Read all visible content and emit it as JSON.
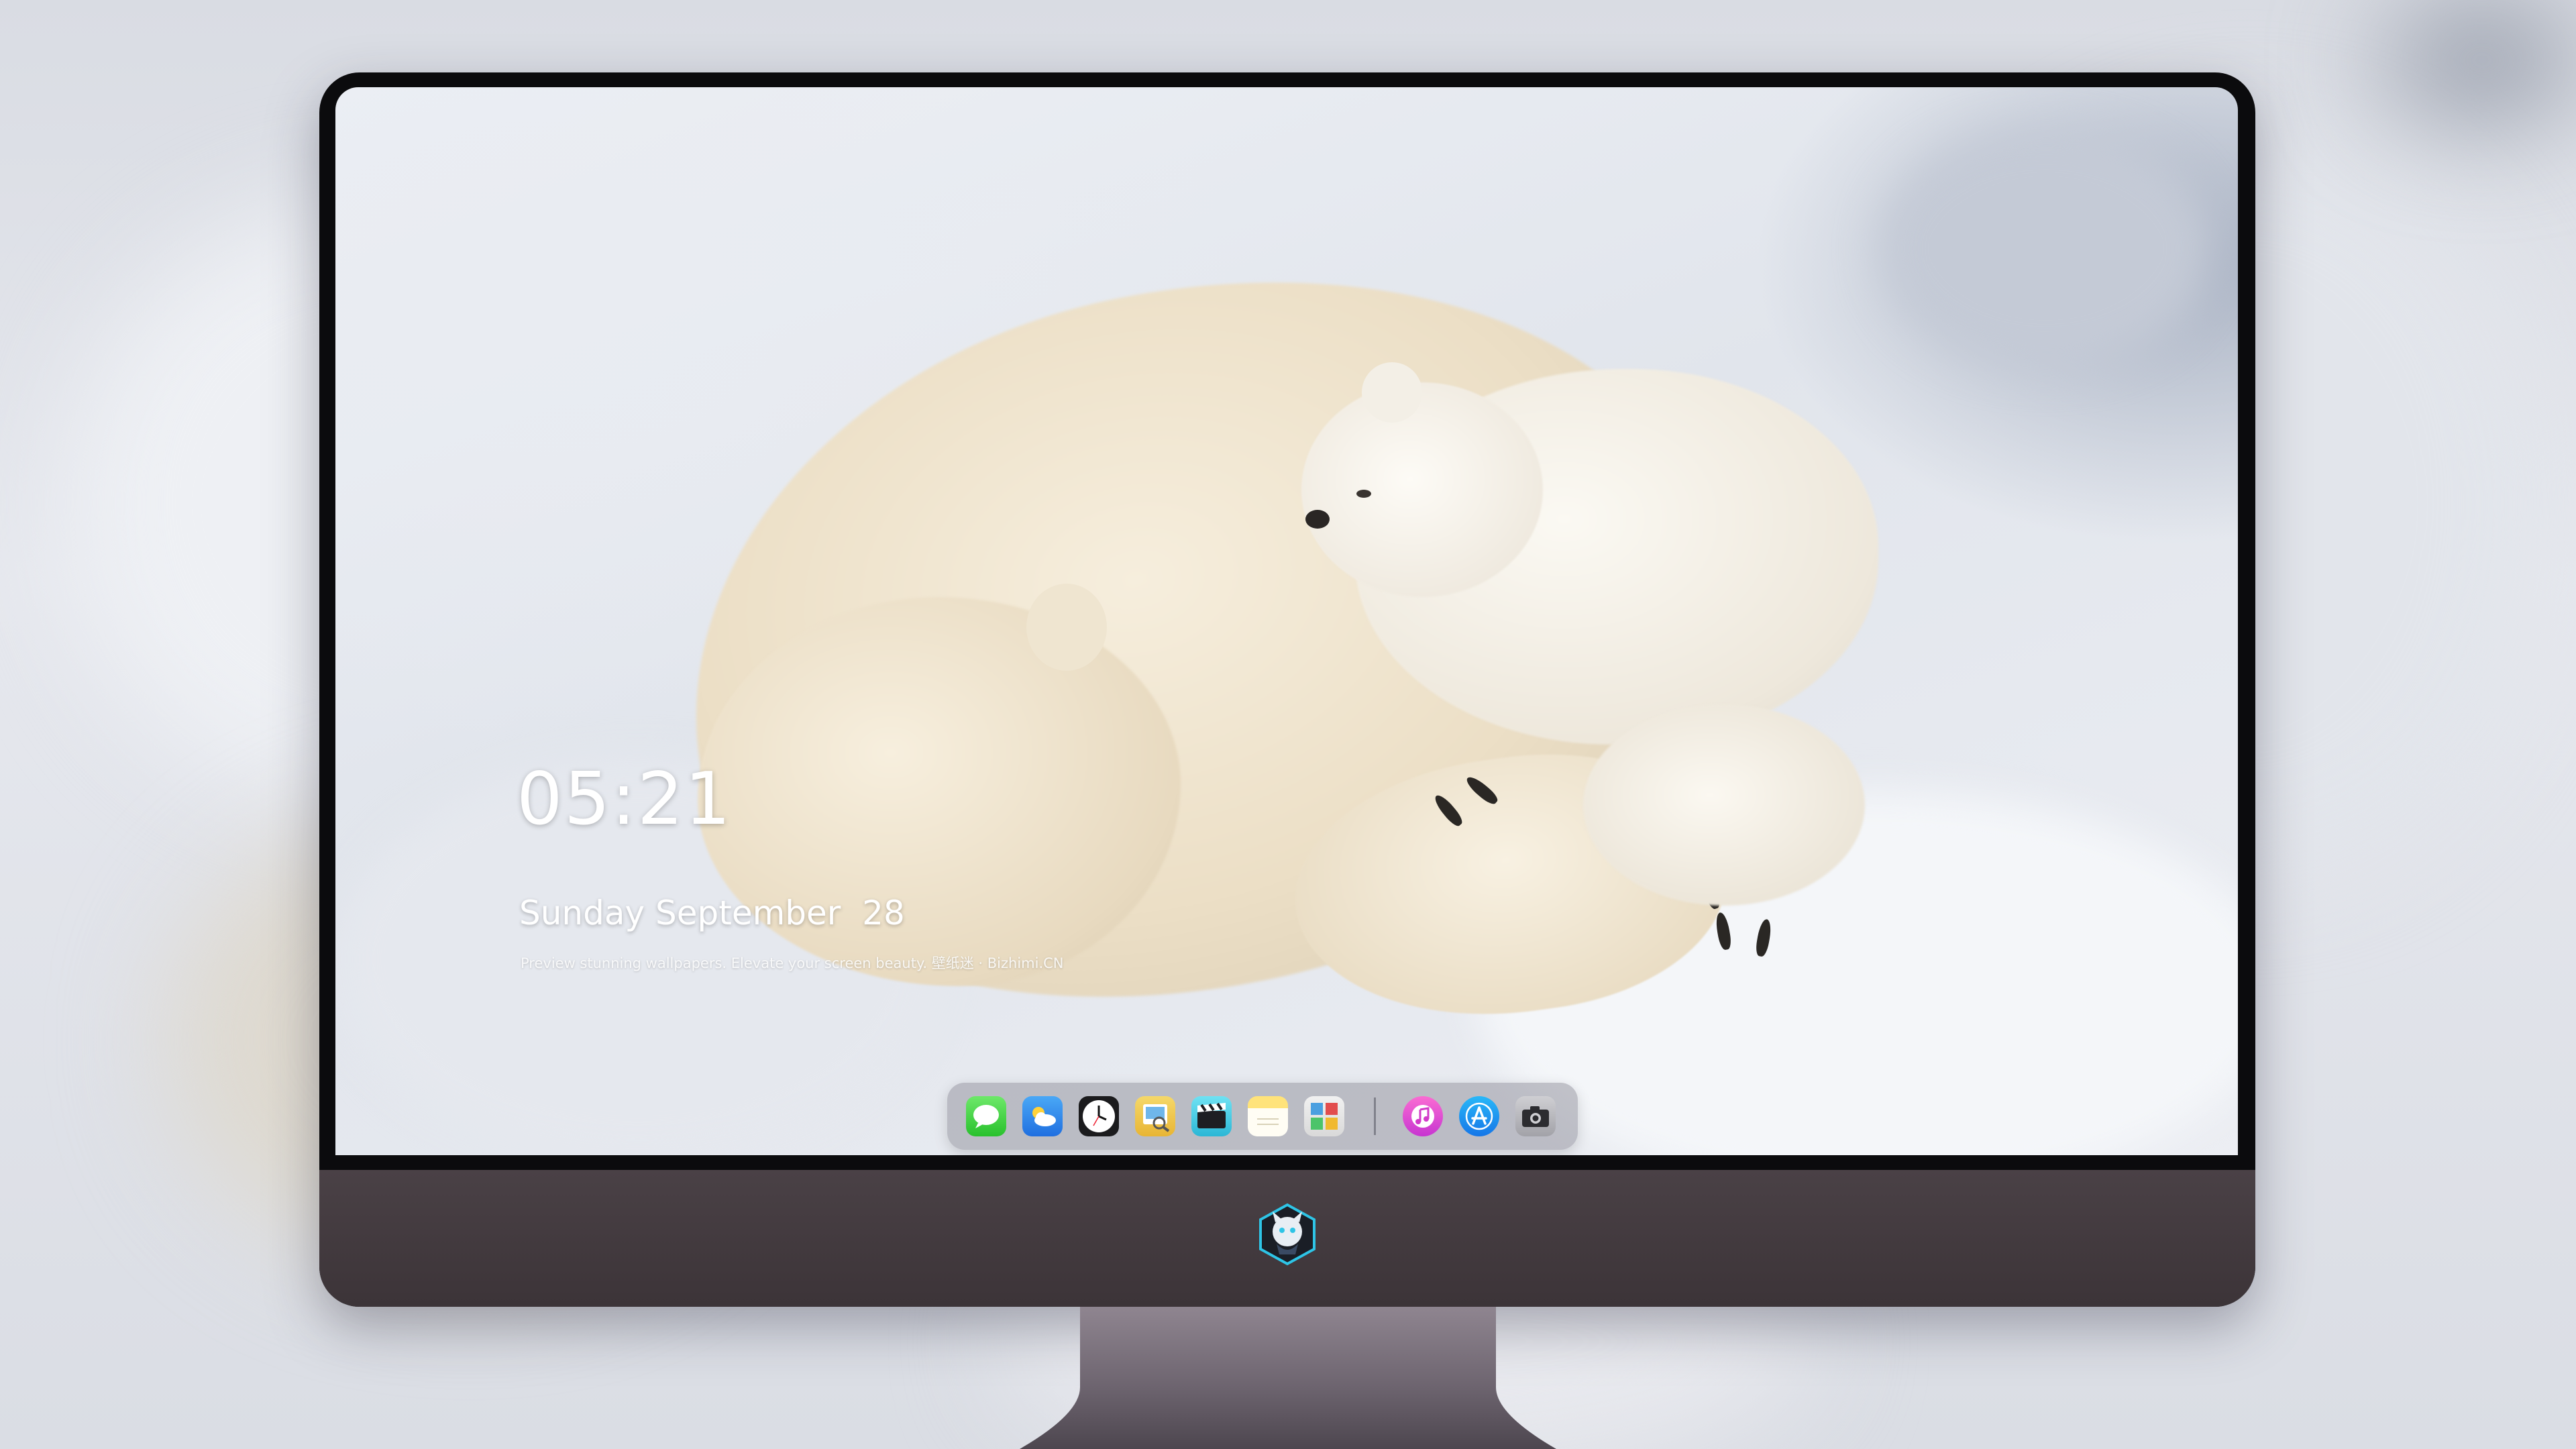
{
  "lockscreen": {
    "time": "05:21",
    "date": "Sunday September  28",
    "tagline": "Preview stunning wallpapers. Elevate your screen beauty. 壁纸迷 · Bizhimi.CN"
  },
  "dock": {
    "apps": [
      {
        "name": "Messages",
        "icon": "messages-icon"
      },
      {
        "name": "Weather",
        "icon": "weather-icon"
      },
      {
        "name": "Clock",
        "icon": "clock-icon"
      },
      {
        "name": "Preview",
        "icon": "preview-icon"
      },
      {
        "name": "Claquette",
        "icon": "clapperboard-icon"
      },
      {
        "name": "Notes",
        "icon": "notes-icon"
      },
      {
        "name": "Photo Booth",
        "icon": "photo-booth-icon"
      }
    ],
    "pinned": [
      {
        "name": "Music",
        "icon": "music-note-icon"
      },
      {
        "name": "App Store",
        "icon": "app-store-icon"
      },
      {
        "name": "Camera",
        "icon": "camera-icon"
      }
    ]
  },
  "colors": {
    "bezel": "#0b0b0d",
    "chin": "#4a4146",
    "dock": "#96969f",
    "logo_accent": "#2ec4e6"
  }
}
